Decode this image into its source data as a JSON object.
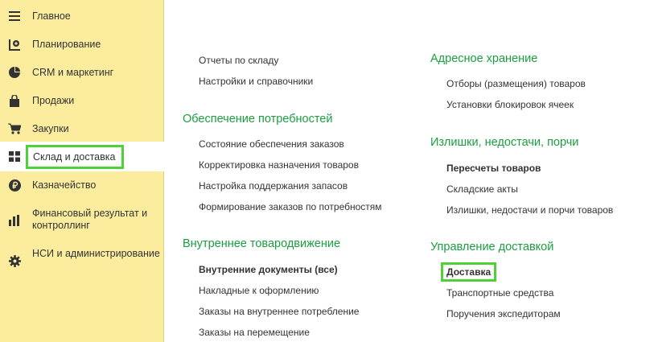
{
  "sidebar": {
    "items": [
      {
        "label": "Главное",
        "icon": "menu-lines-icon"
      },
      {
        "label": "Планирование",
        "icon": "planning-chart-icon"
      },
      {
        "label": "CRM и маркетинг",
        "icon": "pie-chart-icon"
      },
      {
        "label": "Продажи",
        "icon": "shopping-bag-icon"
      },
      {
        "label": "Закупки",
        "icon": "shopping-cart-icon"
      },
      {
        "label": "Склад и доставка",
        "icon": "warehouse-grid-icon"
      },
      {
        "label": "Казначейство",
        "icon": "ruble-coin-icon"
      },
      {
        "label": "Финансовый результат и контроллинг",
        "icon": "bar-chart-icon"
      },
      {
        "label": "НСИ и администрирование",
        "icon": "gear-icon"
      }
    ],
    "active_index": 5,
    "background": "#fbec9e",
    "highlight_color": "#4cd137"
  },
  "content": {
    "left_column": {
      "top_links": [
        "Отчеты по складу",
        "Настройки и справочники"
      ],
      "sections": [
        {
          "title": "Обеспечение потребностей",
          "links": [
            "Состояние обеспечения заказов",
            "Корректировка назначения товаров",
            "Настройка поддержания запасов",
            "Формирование заказов по потребностям"
          ]
        },
        {
          "title": "Внутреннее товародвижение",
          "links": [
            "Внутренние документы (все)",
            "Накладные к оформлению",
            "Заказы на внутреннее потребление",
            "Заказы на перемещение"
          ]
        }
      ]
    },
    "right_column": {
      "sections": [
        {
          "title": "Адресное хранение",
          "links": [
            "Отборы (размещения) товаров",
            "Установки блокировок ячеек"
          ]
        },
        {
          "title": "Излишки, недостачи, порчи",
          "links": [
            "Пересчеты товаров",
            "Складские акты",
            "Излишки, недостачи и порчи товаров"
          ]
        },
        {
          "title": "Управление доставкой",
          "links": [
            "Доставка",
            "Транспортные средства",
            "Поручения экспедиторам"
          ]
        }
      ]
    },
    "section_title_color": "#1a9e3f"
  }
}
